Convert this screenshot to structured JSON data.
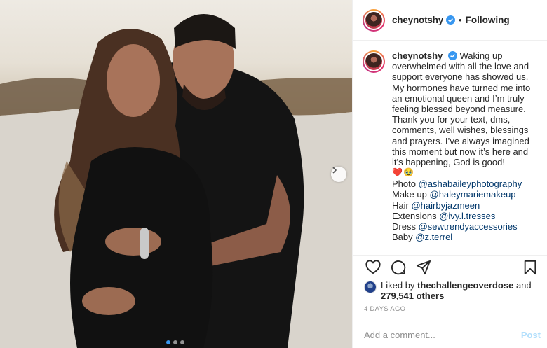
{
  "post": {
    "username": "cheynotshy",
    "separator": "•",
    "follow_status": "Following"
  },
  "caption": {
    "text": "Waking up overwhelmed with all the love and support everyone has showed us. My hormones have turned me into an emotional queen and I’m truly feeling blessed beyond measure. Thank you for your text, dms, comments, well wishes, blessings and prayers. I’ve always imagined this moment but now it’s here and it’s happening, God is good!",
    "emojis": [
      "❤️",
      "🥹"
    ],
    "credits": [
      {
        "label": "Photo",
        "handle": "@ashabaileyphotography"
      },
      {
        "label": "Make up",
        "handle": "@haleymariemakeup"
      },
      {
        "label": "Hair",
        "handle": "@hairbyjazmeen"
      },
      {
        "label": "Extensions",
        "handle": "@ivy.l.tresses"
      },
      {
        "label": "Dress",
        "handle": "@sewtrendyaccessories"
      },
      {
        "label": "Baby",
        "handle": "@z.terrel"
      }
    ]
  },
  "likes": {
    "prefix": "Liked by",
    "user": "thechallengeoverdose",
    "conjunction": "and",
    "count": "279,541 others"
  },
  "date": "4 DAYS AGO",
  "comment_box": {
    "placeholder": "Add a comment...",
    "post_label": "Post"
  },
  "carousel": {
    "total": 3,
    "active_index": 0
  },
  "colors": {
    "verified": "#3897f0",
    "mention": "#00376b",
    "post_disabled": "#b2dffc",
    "meta_gray": "#8e8e8e"
  },
  "icons": {
    "like": "heart-icon",
    "comment": "comment-icon",
    "share": "paper-plane-icon",
    "save": "bookmark-icon",
    "next": "chevron-right-icon",
    "verified": "verified-badge-icon"
  }
}
